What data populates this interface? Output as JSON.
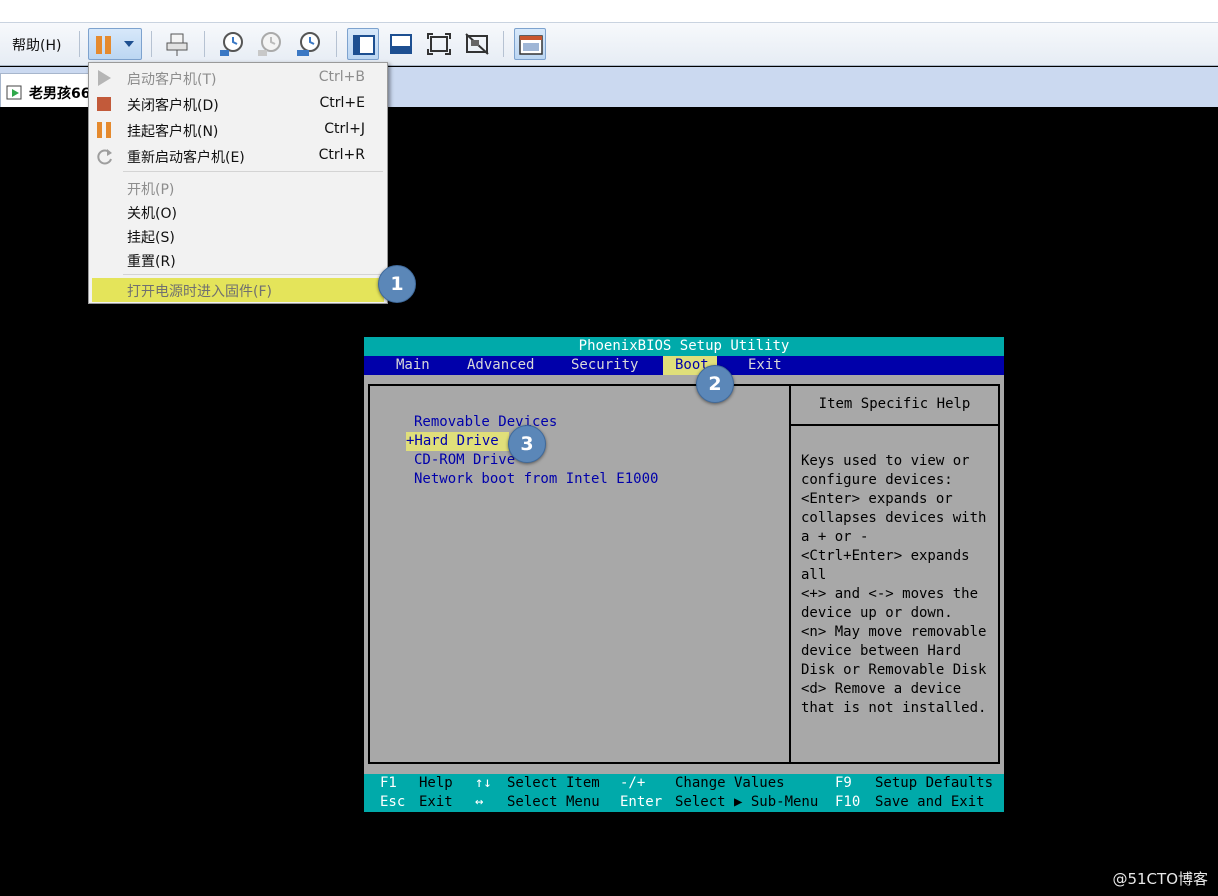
{
  "toolbar": {
    "help_menu": "帮助(H)"
  },
  "vm_tab": {
    "label": "老男孩66"
  },
  "power_menu": {
    "items": [
      {
        "label": "启动客户机(T)",
        "shortcut": "Ctrl+B",
        "enabled": false,
        "icon": "play-icon"
      },
      {
        "label": "关闭客户机(D)",
        "shortcut": "Ctrl+E",
        "enabled": true,
        "icon": "stop-icon"
      },
      {
        "label": "挂起客户机(N)",
        "shortcut": "Ctrl+J",
        "enabled": true,
        "icon": "pause-icon"
      },
      {
        "label": "重新启动客户机(E)",
        "shortcut": "Ctrl+R",
        "enabled": true,
        "icon": "restart-icon"
      },
      {
        "label": "开机(P)",
        "enabled": false
      },
      {
        "label": "关机(O)",
        "enabled": true
      },
      {
        "label": "挂起(S)",
        "enabled": true
      },
      {
        "label": "重置(R)",
        "enabled": true
      },
      {
        "label": "打开电源时进入固件(F)",
        "enabled": true,
        "highlighted": true
      }
    ]
  },
  "callouts": [
    "1",
    "2",
    "3"
  ],
  "bios": {
    "title": "PhoenixBIOS Setup Utility",
    "tabs": [
      "Main",
      "Advanced",
      "Security",
      "Boot",
      "Exit"
    ],
    "active_tab": "Boot",
    "boot_items": [
      "Removable Devices",
      "+Hard Drive",
      "CD-ROM Drive",
      "Network boot from Intel E1000"
    ],
    "selected_item": "+Hard Drive",
    "help_title": "Item Specific Help",
    "help_text": "Keys used to view or\nconfigure devices:\n<Enter> expands or\ncollapses devices with\na + or -\n<Ctrl+Enter> expands\nall\n<+> and <-> moves the\ndevice up or down.\n<n> May move removable\ndevice between Hard\nDisk or Removable Disk\n<d> Remove a device\nthat is not installed.",
    "footer": {
      "row1": [
        {
          "key": "F1",
          "desc": "Help"
        },
        {
          "key": "↑↓",
          "desc": "Select Item"
        },
        {
          "key": "-/+",
          "desc": "Change Values"
        },
        {
          "key": "F9",
          "desc": "Setup Defaults"
        }
      ],
      "row2": [
        {
          "key": "Esc",
          "desc": "Exit"
        },
        {
          "key": "↔",
          "desc": "Select Menu"
        },
        {
          "key": "Enter",
          "desc": "Select ▶ Sub-Menu"
        },
        {
          "key": "F10",
          "desc": "Save and Exit"
        }
      ]
    }
  },
  "colors": {
    "bios_cyan": "#00aaaa",
    "bios_blue": "#0000aa",
    "bios_gray": "#a8a8a8",
    "highlight_yellow": "#e0df7a",
    "callout_blue": "#5b87b8",
    "pause_orange": "#e58a2e"
  },
  "watermark": "@51CTO博客"
}
